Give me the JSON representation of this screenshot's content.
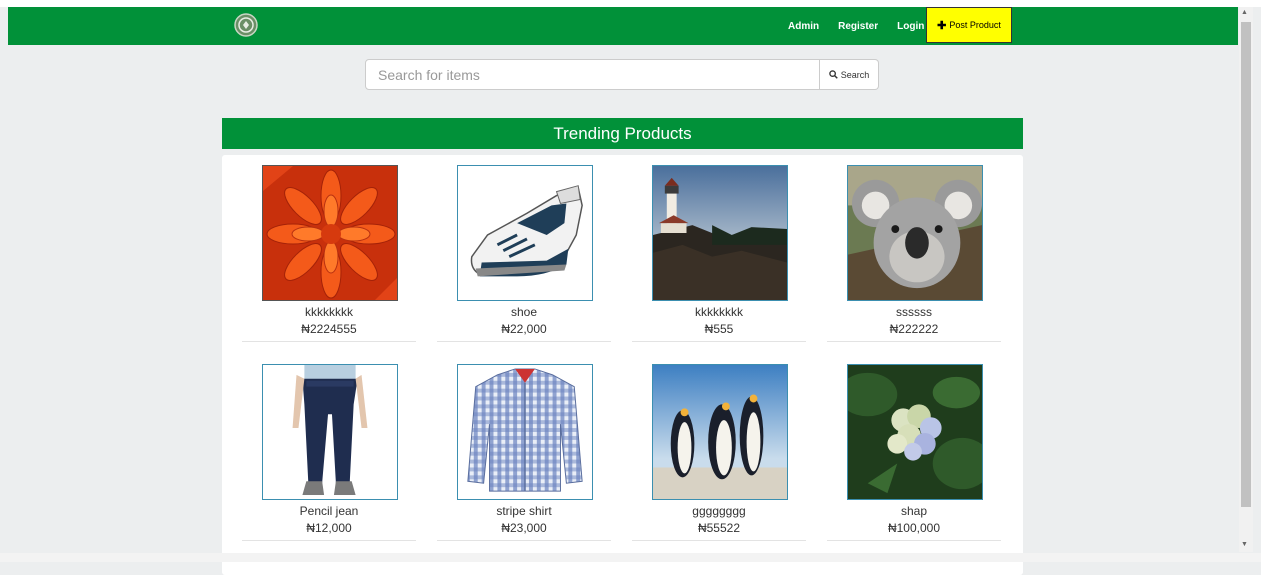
{
  "nav": {
    "links": [
      "Admin",
      "Register",
      "Login"
    ],
    "post_label": "Post Product",
    "post_icon": "plus-icon",
    "logo_icon": "site-logo"
  },
  "search": {
    "placeholder": "Search for items",
    "value": "",
    "button_label": "Search",
    "button_icon": "search-icon"
  },
  "section": {
    "title": "Trending Products"
  },
  "products": [
    {
      "name": "kkkkkkkk",
      "price": "₦2224555",
      "image": "red-flower"
    },
    {
      "name": "shoe",
      "price": "₦22,000",
      "image": "sneaker"
    },
    {
      "name": "kkkkkkkk",
      "price": "₦555",
      "image": "lighthouse"
    },
    {
      "name": "ssssss",
      "price": "₦222222",
      "image": "koala"
    },
    {
      "name": "Pencil jean",
      "price": "₦12,000",
      "image": "jeans"
    },
    {
      "name": "stripe shirt",
      "price": "₦23,000",
      "image": "checked-shirt"
    },
    {
      "name": "gggggggg",
      "price": "₦55522",
      "image": "penguins"
    },
    {
      "name": "shap",
      "price": "₦100,000",
      "image": "hydrangea"
    }
  ],
  "colors": {
    "brand_green": "#019139",
    "post_button": "#ffff00",
    "background": "#eceeef"
  }
}
